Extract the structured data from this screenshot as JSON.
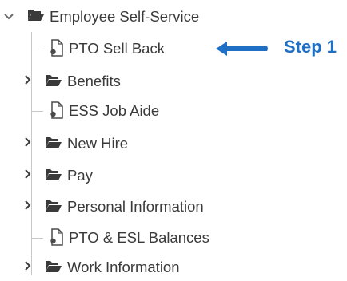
{
  "tree": {
    "root": {
      "label": "Employee Self-Service",
      "expanded": true,
      "icon": "folder-open-icon"
    },
    "children": [
      {
        "type": "document",
        "label": "PTO Sell Back",
        "icon": "document-icon"
      },
      {
        "type": "folder",
        "label": "Benefits",
        "expanded": false,
        "icon": "folder-icon"
      },
      {
        "type": "document",
        "label": "ESS Job Aide",
        "icon": "document-icon"
      },
      {
        "type": "folder",
        "label": "New Hire",
        "expanded": false,
        "icon": "folder-icon"
      },
      {
        "type": "folder",
        "label": "Pay",
        "expanded": false,
        "icon": "folder-icon"
      },
      {
        "type": "folder",
        "label": "Personal Information",
        "expanded": false,
        "icon": "folder-icon"
      },
      {
        "type": "document",
        "label": "PTO & ESL Balances",
        "icon": "document-icon"
      },
      {
        "type": "folder",
        "label": "Work Information",
        "expanded": false,
        "icon": "folder-icon"
      }
    ]
  },
  "callout": {
    "label": "Step 1",
    "color": "#1f6fc4",
    "icon": "arrow-left-icon"
  }
}
